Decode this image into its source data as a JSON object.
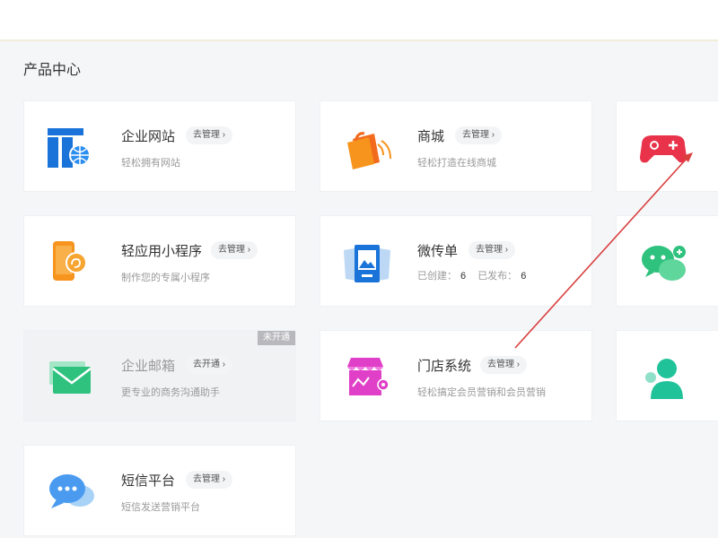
{
  "section_title": "产品中心",
  "manage_label": "去管理",
  "open_label": "去开通",
  "badge_unopened": "未开通",
  "cards": {
    "website": {
      "name": "企业网站",
      "desc": "轻松拥有网站"
    },
    "mall": {
      "name": "商城",
      "desc": "轻松打造在线商城"
    },
    "miniapp": {
      "name": "轻应用小程序",
      "desc": "制作您的专属小程序"
    },
    "h5": {
      "name": "微传单",
      "created_label": "已创建：",
      "created_value": "6",
      "published_label": "已发布：",
      "published_value": "6"
    },
    "mail": {
      "name": "企业邮箱",
      "desc": "更专业的商务沟通助手"
    },
    "store": {
      "name": "门店系统",
      "desc": "轻松搞定会员营销和会员营销"
    },
    "sms": {
      "name": "短信平台",
      "desc": "短信发送营销平台"
    }
  },
  "colors": {
    "annotation_arrow": "#d94040",
    "blue": "#1a73d8",
    "orange": "#f7941d",
    "red": "#e8334a",
    "green": "#2ec27e",
    "magenta": "#e040c8",
    "teal": "#20c29a",
    "chat_blue": "#4a9bf0"
  }
}
